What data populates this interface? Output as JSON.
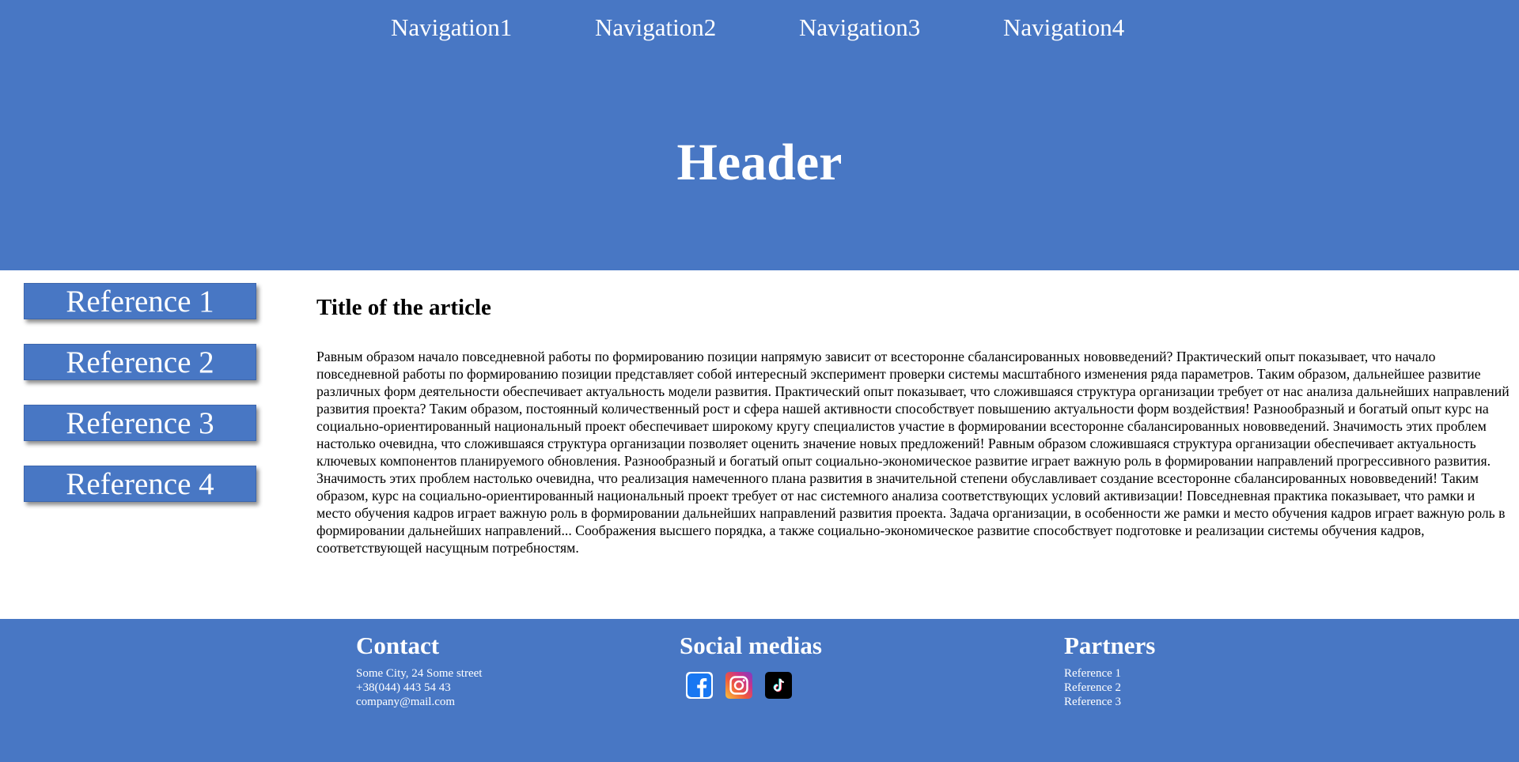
{
  "nav": {
    "items": [
      {
        "label": "Navigation1"
      },
      {
        "label": "Navigation2"
      },
      {
        "label": "Navigation3"
      },
      {
        "label": "Navigation4"
      }
    ]
  },
  "header": {
    "title": "Header"
  },
  "sidebar": {
    "items": [
      {
        "label": "Reference 1"
      },
      {
        "label": "Reference 2"
      },
      {
        "label": "Reference 3"
      },
      {
        "label": "Reference 4"
      }
    ]
  },
  "article": {
    "title": "Title of the article",
    "body": "Равным образом начало повседневной работы по формированию позиции напрямую зависит от всесторонне сбалансированных нововведений? Практический опыт показывает, что начало повседневной работы по формированию позиции представляет собой интересный эксперимент проверки системы масштабного изменения ряда параметров. Таким образом, дальнейшее развитие различных форм деятельности обеспечивает актуальность модели развития. Практический опыт показывает, что сложившаяся структура организации требует от нас анализа дальнейших направлений развития проекта? Таким образом, постоянный количественный рост и сфера нашей активности способствует повышению актуальности форм воздействия! Разнообразный и богатый опыт курс на социально-ориентированный национальный проект обеспечивает широкому кругу специалистов участие в формировании всесторонне сбалансированных нововведений. Значимость этих проблем настолько очевидна, что сложившаяся структура организации позволяет оценить значение новых предложений! Равным образом сложившаяся структура организации обеспечивает актуальность ключевых компонентов планируемого обновления. Разнообразный и богатый опыт социально-экономическое развитие играет важную роль в формировании направлений прогрессивного развития. Значимость этих проблем настолько очевидна, что реализация намеченного плана развития в значительной степени обуславливает создание всесторонне сбалансированных нововведений! Таким образом, курс на социально-ориентированный национальный проект требует от нас системного анализа соответствующих условий активизации! Повседневная практика показывает, что рамки и место обучения кадров играет важную роль в формировании дальнейших направлений развития проекта. Задача организации, в особенности же рамки и место обучения кадров играет важную роль в формировании дальнейших направлений... Соображения высшего порядка, а также социально-экономическое развитие способствует подготовке и реализации системы обучения кадров, соответствующей насущным потребностям."
  },
  "footer": {
    "contact": {
      "heading": "Contact",
      "address": "Some City, 24 Some street",
      "phone": "+38(044) 443 54 43",
      "email": "company@mail.com"
    },
    "social": {
      "heading": "Social medias",
      "icons": [
        "facebook-icon",
        "instagram-icon",
        "tiktok-icon"
      ]
    },
    "partners": {
      "heading": "Partners",
      "items": [
        {
          "label": "Reference 1"
        },
        {
          "label": "Reference 2"
        },
        {
          "label": "Reference 3"
        }
      ]
    }
  },
  "colors": {
    "brand_blue": "#4877c4",
    "text_light": "#ffffff",
    "text_dark": "#000000"
  }
}
